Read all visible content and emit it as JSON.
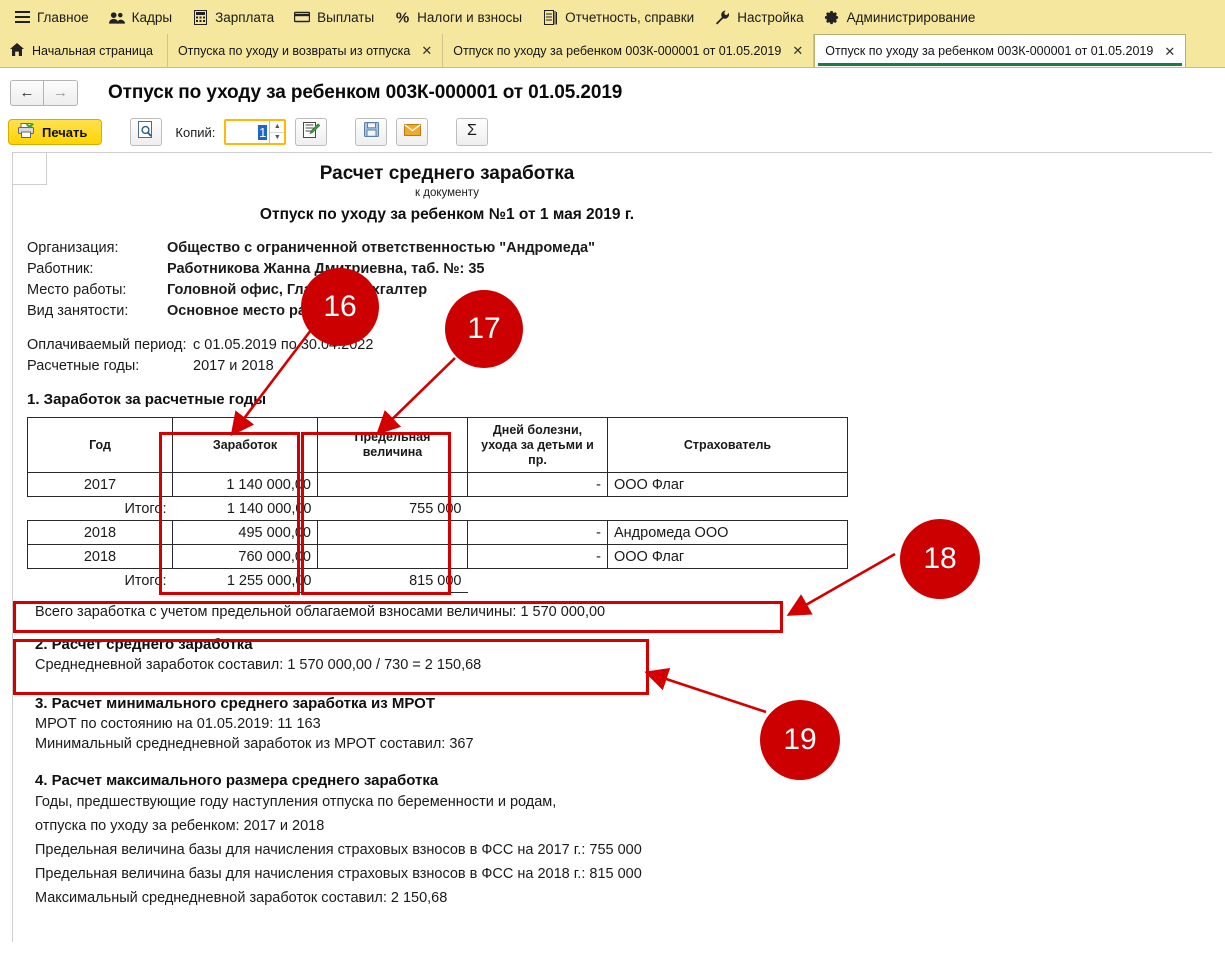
{
  "menubar": {
    "items": [
      {
        "label": "Главное",
        "icon": "hamburger-icon"
      },
      {
        "label": "Кадры",
        "icon": "people-icon"
      },
      {
        "label": "Зарплата",
        "icon": "calculator-icon"
      },
      {
        "label": "Выплаты",
        "icon": "wallet-icon"
      },
      {
        "label": "Налоги и взносы",
        "icon": "percent-icon"
      },
      {
        "label": "Отчетность, справки",
        "icon": "report-icon"
      },
      {
        "label": "Настройка",
        "icon": "wrench-icon"
      },
      {
        "label": "Администрирование",
        "icon": "gear-icon"
      }
    ]
  },
  "tabs": [
    {
      "label": "Начальная страница",
      "closable": false,
      "active": false
    },
    {
      "label": "Отпуска по уходу и возвраты из отпуска",
      "closable": true,
      "active": false
    },
    {
      "label": "Отпуск по уходу за ребенком 003К-000001 от 01.05.2019",
      "closable": true,
      "active": false
    },
    {
      "label": "Отпуск по уходу за ребенком 003К-000001 от 01.05.2019",
      "closable": true,
      "active": true
    }
  ],
  "nav": {
    "back": "←",
    "forward": "→",
    "doc_title": "Отпуск по уходу за ребенком 003К-000001 от 01.05.2019"
  },
  "toolbar": {
    "print_label": "Печать",
    "print_icon": "printer-icon",
    "preview_icon": "print-preview-icon",
    "copies_label": "Копий:",
    "copies_value": "1",
    "edit_icon": "edit-doc-icon",
    "save_icon": "floppy-save-icon",
    "mail_icon": "envelope-icon",
    "sum_icon": "sigma-icon"
  },
  "report": {
    "title": "Расчет среднего заработка",
    "subtitle": "к документу",
    "doc_line": "Отпуск по уходу за ребенком №1 от 1 мая 2019 г.",
    "fields": [
      {
        "key": "Организация:",
        "value": "Общество с ограниченной ответственностью \"Андромеда\""
      },
      {
        "key": "Работник:",
        "value": "Работникова Жанна Дмитриевна, таб. №: 35"
      },
      {
        "key": "Место работы:",
        "value": "Головной офис, Главный бухгалтер"
      },
      {
        "key": "Вид занятости:",
        "value": "Основное место работы"
      }
    ],
    "period_key": "Оплачиваемый период:",
    "period_value": "с 01.05.2019 по 30.04.2022",
    "years_key": "Расчетные годы:",
    "years_value": "2017 и 2018",
    "section1_title": "1. Заработок за расчетные годы",
    "table": {
      "headers": [
        "Год",
        "Заработок",
        "Предельная величина",
        "Дней болезни, ухода за детьми и пр.",
        "Страхователь"
      ],
      "rows": [
        {
          "type": "data",
          "year": "2017",
          "earn": "1 140 000,00",
          "limit": "",
          "days": "-",
          "insurer": "ООО Флаг"
        },
        {
          "type": "total",
          "year": "Итого:",
          "earn": "1 140 000,00",
          "limit": "755 000",
          "days": "",
          "insurer": ""
        },
        {
          "type": "data",
          "year": "2018",
          "earn": "495 000,00",
          "limit": "",
          "days": "-",
          "insurer": "Андромеда ООО"
        },
        {
          "type": "data",
          "year": "2018",
          "earn": "760 000,00",
          "limit": "",
          "days": "-",
          "insurer": "ООО Флаг"
        },
        {
          "type": "total",
          "year": "Итого:",
          "earn": "1 255 000,00",
          "limit": "815 000",
          "days": "",
          "insurer": ""
        }
      ]
    },
    "total_line": "Всего заработка с учетом предельной облагаемой взносами величины: 1 570 000,00",
    "section2_title": "2. Расчет среднего заработка",
    "section2_line": "Среднедневной заработок составил: 1 570 000,00 / 730 = 2 150,68",
    "section3_title": "3. Расчет минимального среднего заработка из МРОТ",
    "section3_lines": [
      "МРОТ по состоянию на 01.05.2019: 11 163",
      "Минимальный среднедневной заработок из МРОТ составил: 367"
    ],
    "section4_title": "4. Расчет максимального размера среднего заработка",
    "section4_lines": [
      "Годы, предшествующие году наступления отпуска по беременности и родам,",
      "отпуска по уходу за ребенком: 2017 и 2018",
      "Предельная величина базы для начисления страховых взносов в ФСС на 2017 г.: 755 000",
      "Предельная величина базы для начисления страховых взносов в ФСС на 2018 г.: 815 000",
      "Максимальный среднедневной заработок составил: 2 150,68"
    ]
  },
  "annotations": {
    "accent_color": "#cc0000",
    "markers": [
      {
        "number": "16"
      },
      {
        "number": "17"
      },
      {
        "number": "18"
      },
      {
        "number": "19"
      }
    ]
  }
}
